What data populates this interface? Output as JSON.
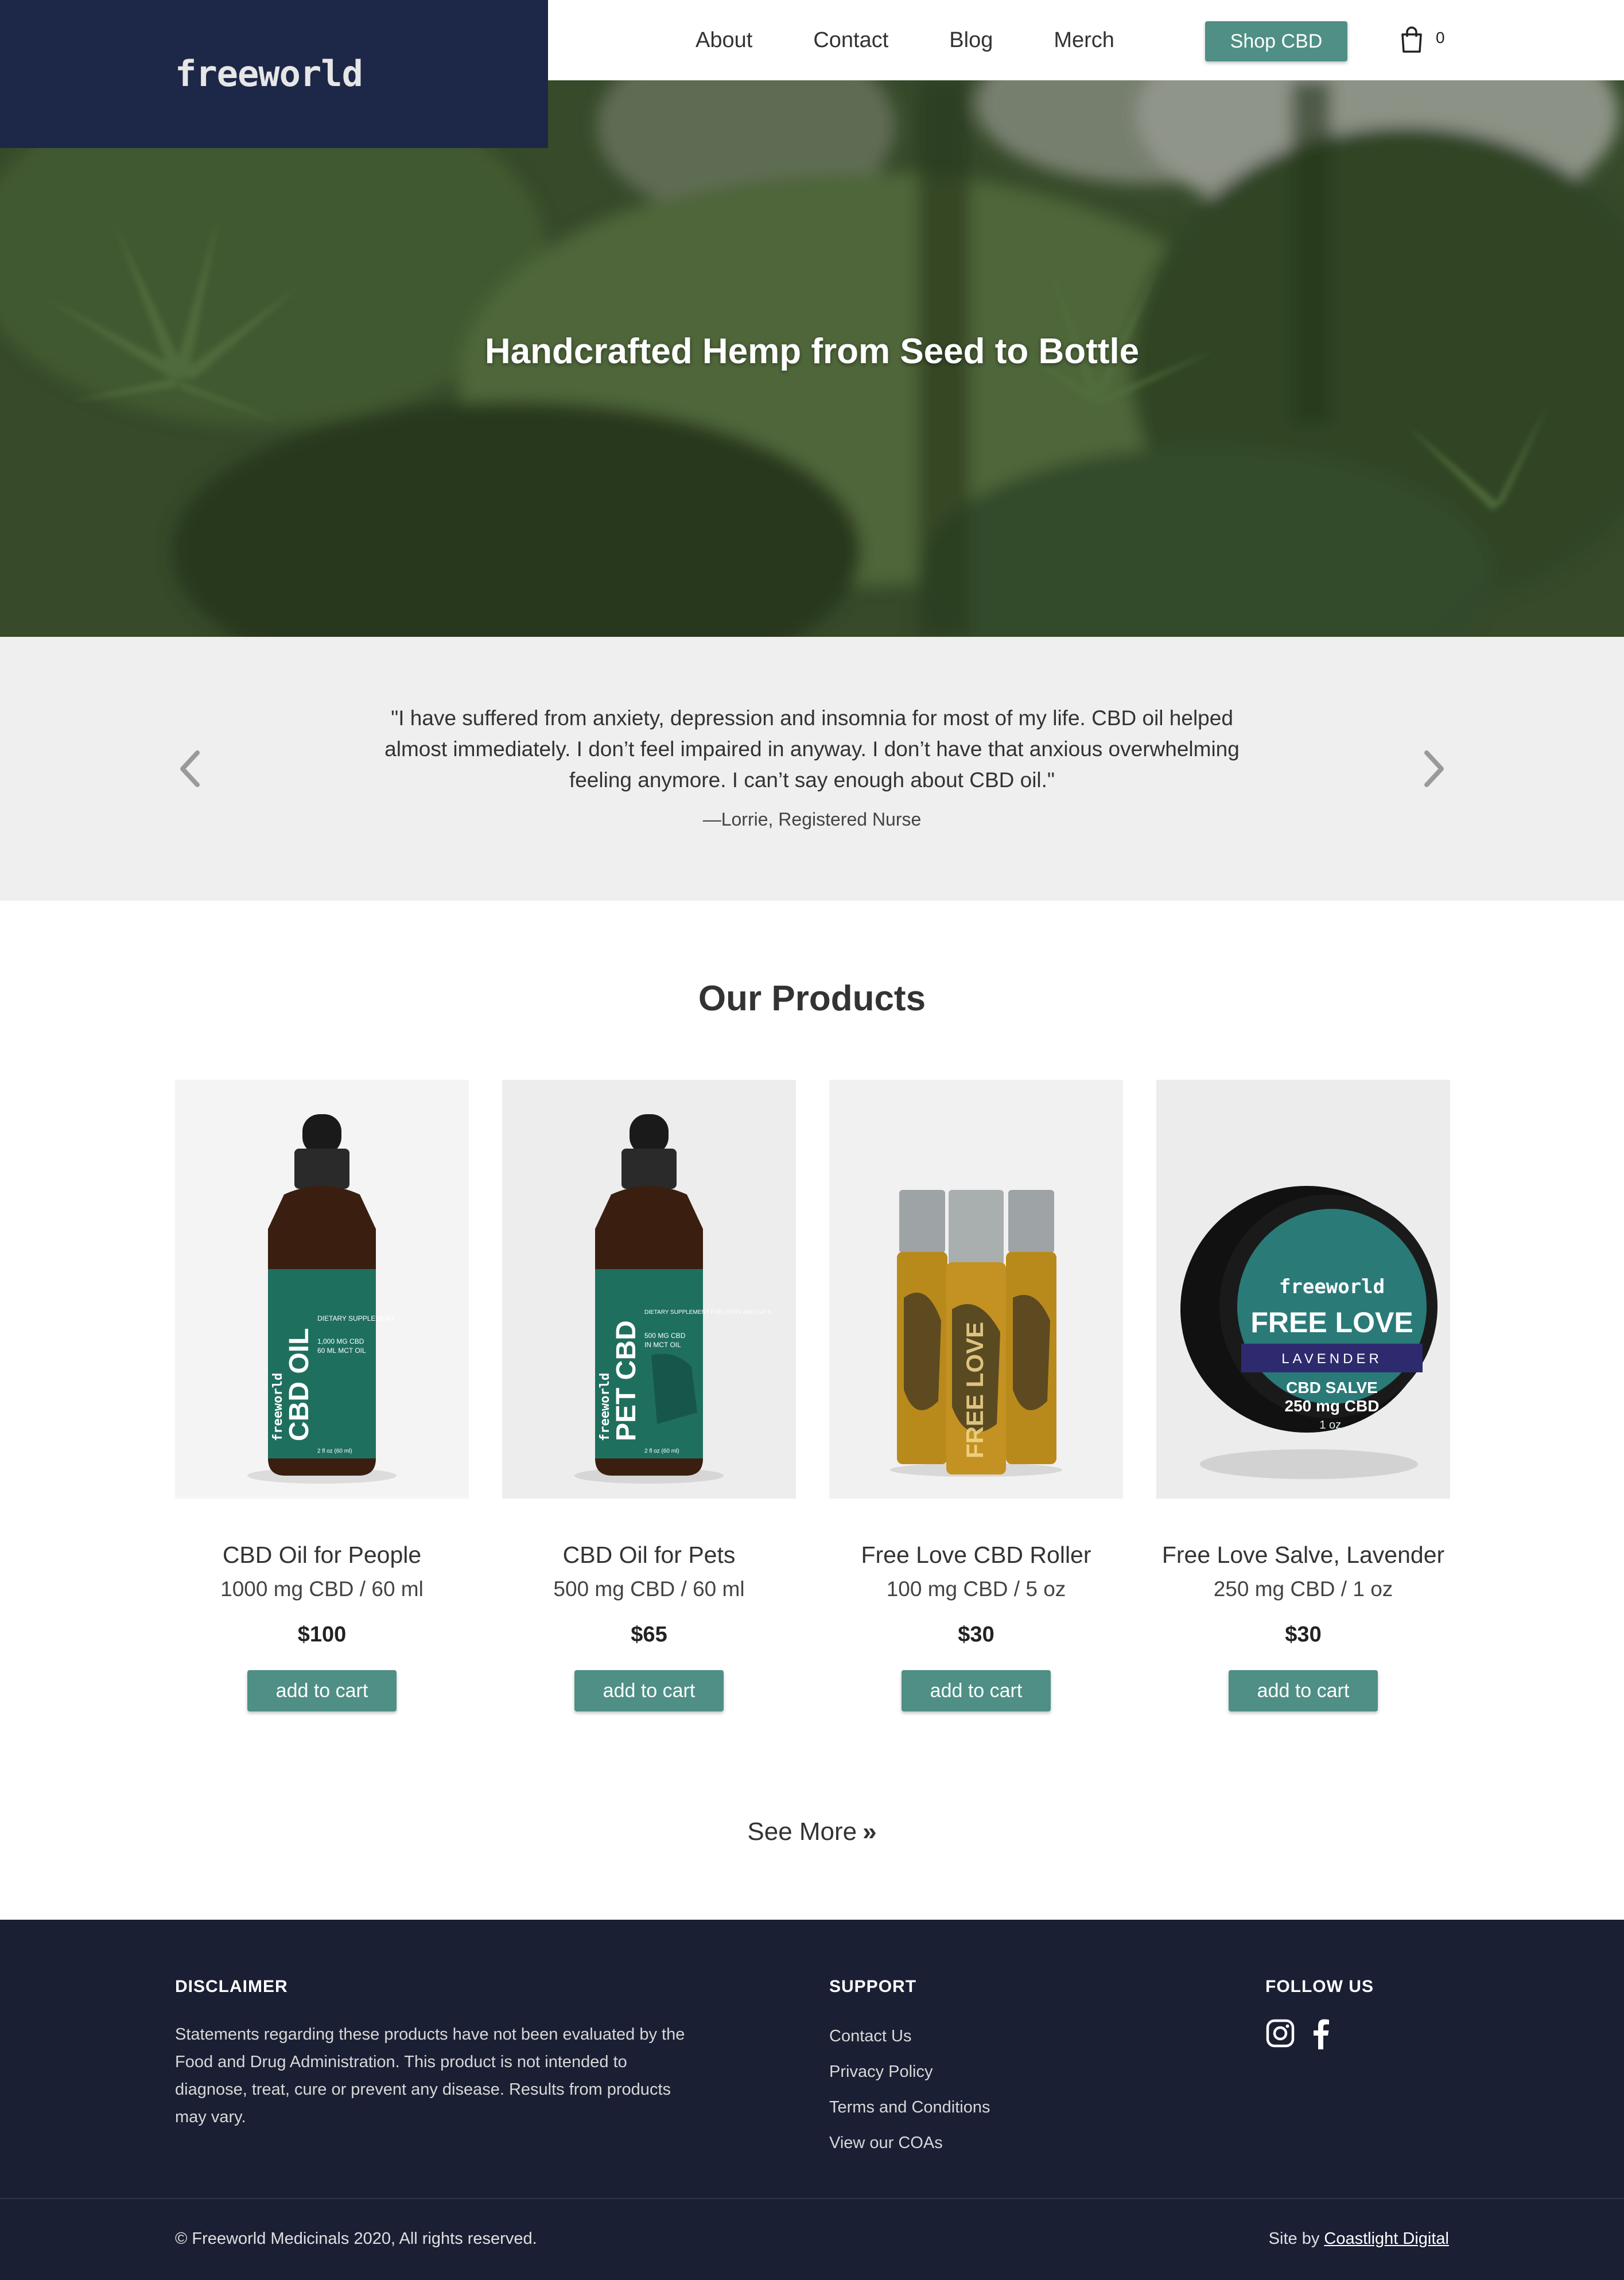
{
  "header": {
    "logo_text": "freeworld",
    "nav": [
      "About",
      "Contact",
      "Blog",
      "Merch"
    ],
    "shop_button": "Shop CBD",
    "cart_count": "0",
    "brand_color": "#1d2747",
    "accent_color": "#4f8f85"
  },
  "hero": {
    "title": "Handcrafted Hemp from Seed to Bottle"
  },
  "testimonial": {
    "quote": "\"I have suffered from anxiety, depression and insomnia for most of my life. CBD oil helped almost immediately. I don’t feel impaired in anyway. I don’t have that anxious overwhelming feeling anymore. I can’t say enough about CBD oil.\"",
    "author": "—Lorrie, Registered Nurse"
  },
  "products_section": {
    "title": "Our Products",
    "products": [
      {
        "name": "CBD Oil for People",
        "desc": "1000 mg CBD / 60 ml",
        "price": "$100",
        "button": "add to cart",
        "label_lines": [
          "freeworld",
          "CBD OIL",
          "DIETARY SUPPLEMENT",
          "1,000 MG CBD",
          "60 ML MCT OIL",
          "2 fl oz (60 ml)"
        ]
      },
      {
        "name": "CBD Oil for Pets",
        "desc": "500 mg CBD / 60 ml",
        "price": "$65",
        "button": "add to cart",
        "label_lines": [
          "freeworld",
          "PET CBD",
          "DIETARY SUPPLEMENT FOR DOGS AND CATS",
          "500 MG CBD",
          "IN MCT OIL",
          "2 fl oz (60 ml)"
        ]
      },
      {
        "name": "Free Love CBD Roller",
        "desc": "100 mg CBD / 5 oz",
        "price": "$30",
        "button": "add to cart",
        "label_lines": [
          "FREE LOVE"
        ]
      },
      {
        "name": "Free Love Salve, Lavender",
        "desc": "250 mg CBD / 1 oz",
        "price": "$30",
        "button": "add to cart",
        "label_lines": [
          "freeworld",
          "FREE LOVE",
          "LAVENDER",
          "CBD SALVE",
          "250 mg CBD",
          "1 oz."
        ]
      }
    ],
    "see_more": "See More"
  },
  "footer": {
    "disclaimer_heading": "DISCLAIMER",
    "disclaimer_text": "Statements regarding these products have not been evaluated by the Food and Drug Administration. This product is not intended to diagnose, treat, cure or prevent any disease. Results from products may vary.",
    "support_heading": "SUPPORT",
    "support_links": [
      "Contact Us",
      "Privacy Policy",
      "Terms and Conditions",
      "View our COAs"
    ],
    "follow_heading": "FOLLOW US",
    "social_icons": [
      "instagram-icon",
      "facebook-icon"
    ],
    "copyright": "© Freeworld Medicinals 2020, All rights reserved.",
    "credit_prefix": "Site by ",
    "credit_link": "Coastlight Digital"
  }
}
